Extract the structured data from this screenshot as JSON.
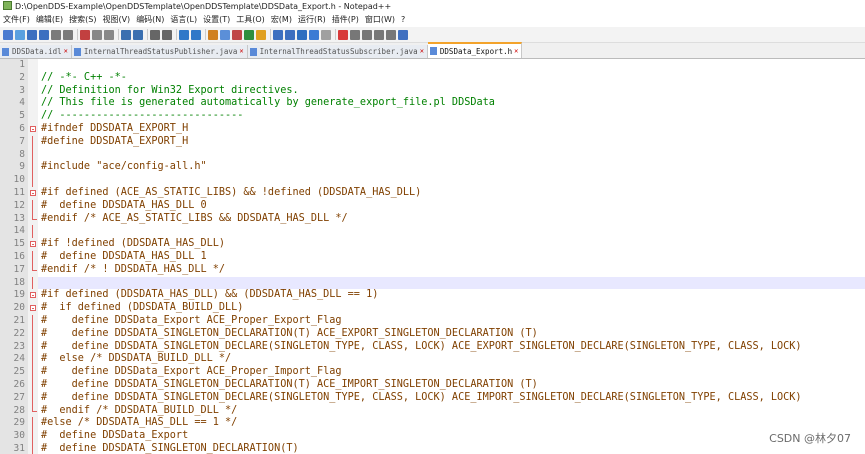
{
  "window": {
    "title": "D:\\OpenDDS-Example\\OpenDDSTemplate\\OpenDDSTemplate\\DDSData_Export.h - Notepad++"
  },
  "menu": [
    "文件(F)",
    "编辑(E)",
    "搜索(S)",
    "视图(V)",
    "编码(N)",
    "语言(L)",
    "设置(T)",
    "工具(O)",
    "宏(M)",
    "运行(R)",
    "插件(P)",
    "窗口(W)",
    "?"
  ],
  "tabs": [
    {
      "label": "DDSData.idl",
      "close": "✕",
      "active": false
    },
    {
      "label": "InternalThreadStatusPublisher.java",
      "close": "✕",
      "active": false
    },
    {
      "label": "InternalThreadStatusSubscriber.java",
      "close": "✕",
      "active": false
    },
    {
      "label": "DDSData_Export.h",
      "close": "✕",
      "active": true
    }
  ],
  "lines": [
    {
      "n": "1",
      "t": "",
      "c": false,
      "f": ""
    },
    {
      "n": "2",
      "t": "// -*- C++ -*-",
      "c": true,
      "f": ""
    },
    {
      "n": "3",
      "t": "// Definition for Win32 Export directives.",
      "c": true,
      "f": ""
    },
    {
      "n": "4",
      "t": "// This file is generated automatically by generate_export_file.pl DDSData",
      "c": true,
      "f": ""
    },
    {
      "n": "5",
      "t": "// ------------------------------",
      "c": true,
      "f": ""
    },
    {
      "n": "6",
      "t": "#ifndef DDSDATA_EXPORT_H",
      "c": false,
      "f": "open"
    },
    {
      "n": "7",
      "t": "#define DDSDATA_EXPORT_H",
      "c": false,
      "f": "line"
    },
    {
      "n": "8",
      "t": "",
      "c": false,
      "f": "line"
    },
    {
      "n": "9",
      "t": "#include \"ace/config-all.h\"",
      "c": false,
      "f": "line"
    },
    {
      "n": "10",
      "t": "",
      "c": false,
      "f": "line"
    },
    {
      "n": "11",
      "t": "#if defined (ACE_AS_STATIC_LIBS) && !defined (DDSDATA_HAS_DLL)",
      "c": false,
      "f": "open"
    },
    {
      "n": "12",
      "t": "#  define DDSDATA_HAS_DLL 0",
      "c": false,
      "f": "line"
    },
    {
      "n": "13",
      "t": "#endif /* ACE_AS_STATIC_LIBS && DDSDATA_HAS_DLL */",
      "c": false,
      "f": "end"
    },
    {
      "n": "14",
      "t": "",
      "c": false,
      "f": "line"
    },
    {
      "n": "15",
      "t": "#if !defined (DDSDATA_HAS_DLL)",
      "c": false,
      "f": "open"
    },
    {
      "n": "16",
      "t": "#  define DDSDATA_HAS_DLL 1",
      "c": false,
      "f": "line"
    },
    {
      "n": "17",
      "t": "#endif /* ! DDSDATA_HAS_DLL */",
      "c": false,
      "f": "end"
    },
    {
      "n": "18",
      "t": "",
      "c": false,
      "f": "line",
      "cur": true
    },
    {
      "n": "19",
      "t": "#if defined (DDSDATA_HAS_DLL) && (DDSDATA_HAS_DLL == 1)",
      "c": false,
      "f": "open"
    },
    {
      "n": "20",
      "t": "#  if defined (DDSDATA_BUILD_DLL)",
      "c": false,
      "f": "open"
    },
    {
      "n": "21",
      "t": "#    define DDSData_Export ACE_Proper_Export_Flag",
      "c": false,
      "f": "line"
    },
    {
      "n": "22",
      "t": "#    define DDSDATA_SINGLETON_DECLARATION(T) ACE_EXPORT_SINGLETON_DECLARATION (T)",
      "c": false,
      "f": "line"
    },
    {
      "n": "23",
      "t": "#    define DDSDATA_SINGLETON_DECLARE(SINGLETON_TYPE, CLASS, LOCK) ACE_EXPORT_SINGLETON_DECLARE(SINGLETON_TYPE, CLASS, LOCK)",
      "c": false,
      "f": "line"
    },
    {
      "n": "24",
      "t": "#  else /* DDSDATA_BUILD_DLL */",
      "c": false,
      "f": "line"
    },
    {
      "n": "25",
      "t": "#    define DDSData_Export ACE_Proper_Import_Flag",
      "c": false,
      "f": "line"
    },
    {
      "n": "26",
      "t": "#    define DDSDATA_SINGLETON_DECLARATION(T) ACE_IMPORT_SINGLETON_DECLARATION (T)",
      "c": false,
      "f": "line"
    },
    {
      "n": "27",
      "t": "#    define DDSDATA_SINGLETON_DECLARE(SINGLETON_TYPE, CLASS, LOCK) ACE_IMPORT_SINGLETON_DECLARE(SINGLETON_TYPE, CLASS, LOCK)",
      "c": false,
      "f": "line"
    },
    {
      "n": "28",
      "t": "#  endif /* DDSDATA_BUILD_DLL */",
      "c": false,
      "f": "end"
    },
    {
      "n": "29",
      "t": "#else /* DDSDATA_HAS_DLL == 1 */",
      "c": false,
      "f": "line"
    },
    {
      "n": "30",
      "t": "#  define DDSData_Export",
      "c": false,
      "f": "line"
    },
    {
      "n": "31",
      "t": "#  define DDSDATA_SINGLETON_DECLARATION(T)",
      "c": false,
      "f": "line"
    }
  ],
  "watermark": "CSDN @林夕07"
}
